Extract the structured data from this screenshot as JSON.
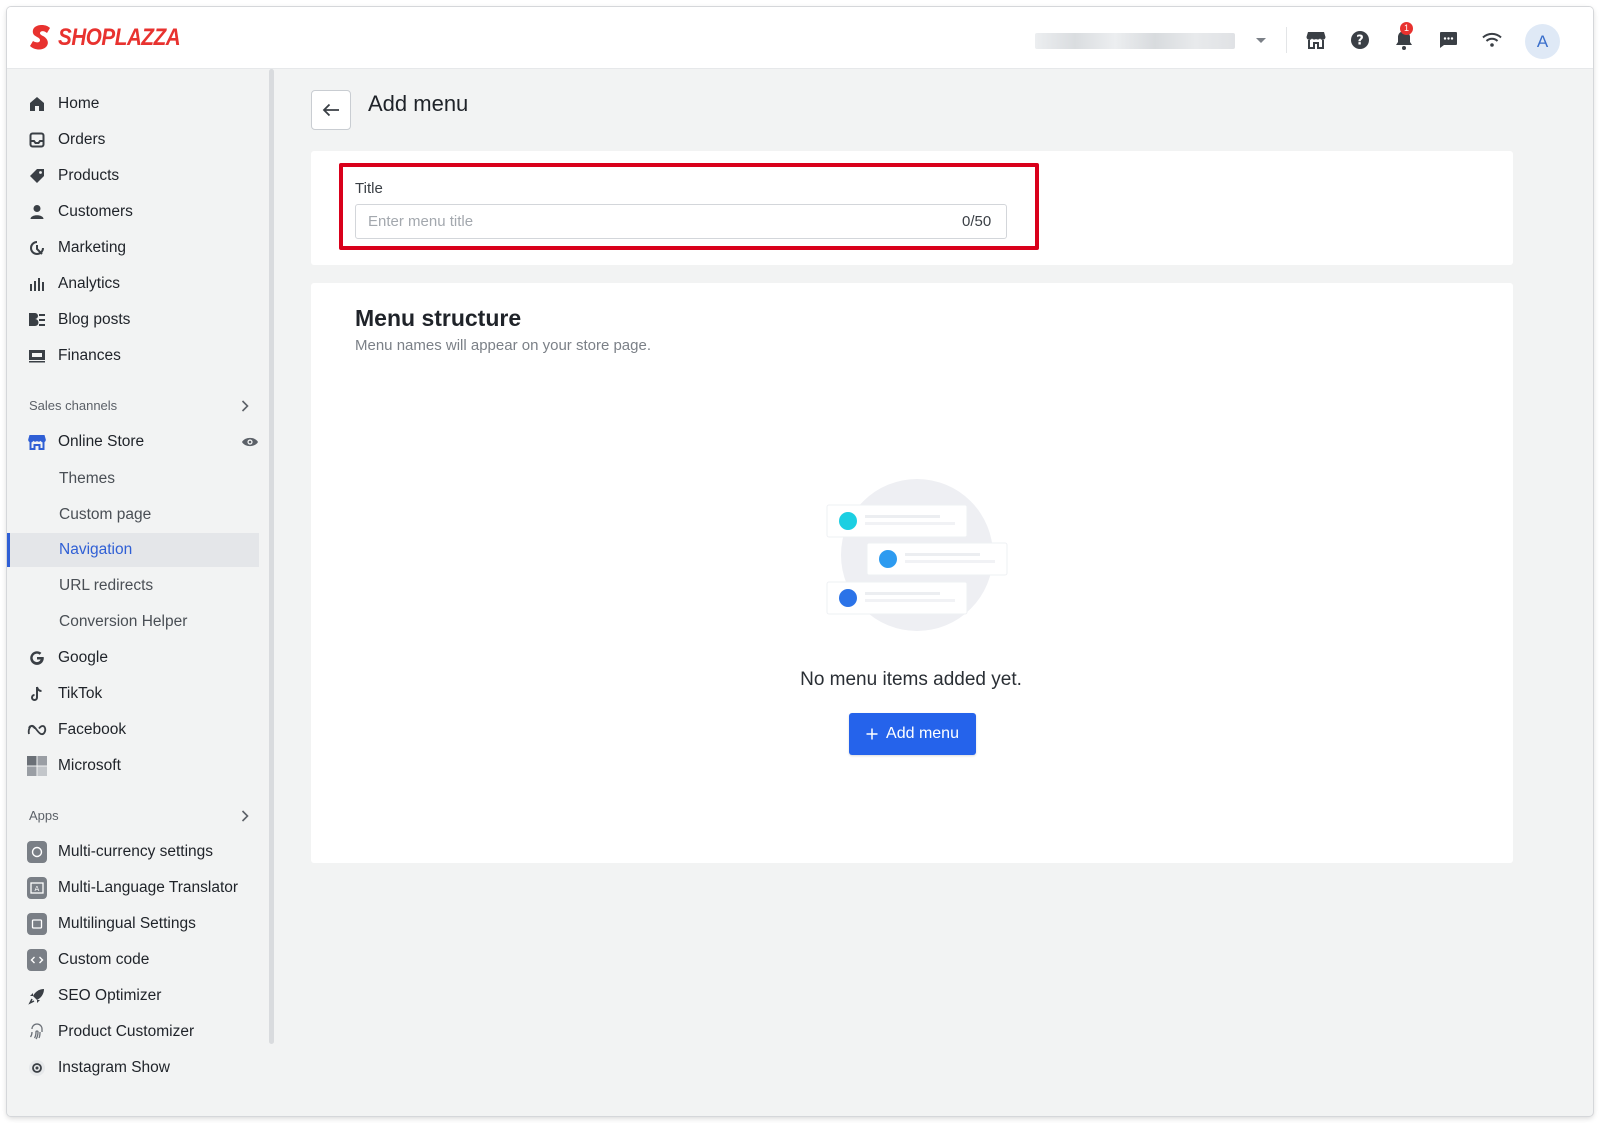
{
  "brand": {
    "name": "SHOPLAZZA",
    "color": "#e8322f"
  },
  "topbar": {
    "icons": [
      "store-icon",
      "help-icon",
      "bell-icon",
      "chat-icon",
      "wifi-icon"
    ],
    "notification_count": "1",
    "avatar_initial": "A"
  },
  "sidebar": {
    "main": [
      {
        "label": "Home",
        "icon": "home-icon"
      },
      {
        "label": "Orders",
        "icon": "orders-icon"
      },
      {
        "label": "Products",
        "icon": "tag-icon"
      },
      {
        "label": "Customers",
        "icon": "person-icon"
      },
      {
        "label": "Marketing",
        "icon": "marketing-icon"
      },
      {
        "label": "Analytics",
        "icon": "bar-chart-icon"
      },
      {
        "label": "Blog posts",
        "icon": "blog-icon"
      },
      {
        "label": "Finances",
        "icon": "finance-icon"
      }
    ],
    "sales_channels_label": "Sales channels",
    "online_store": "Online Store",
    "online_store_sub": [
      "Themes",
      "Custom page",
      "Navigation",
      "URL redirects",
      "Conversion Helper"
    ],
    "channels": [
      {
        "label": "Google",
        "icon": "google-icon"
      },
      {
        "label": "TikTok",
        "icon": "tiktok-icon"
      },
      {
        "label": "Facebook",
        "icon": "meta-icon"
      },
      {
        "label": "Microsoft",
        "icon": "microsoft-icon"
      }
    ],
    "apps_label": "Apps",
    "apps": [
      {
        "label": "Multi-currency settings",
        "icon": "currency-app-icon"
      },
      {
        "label": "Multi-Language Translator",
        "icon": "translator-app-icon"
      },
      {
        "label": "Multilingual Settings",
        "icon": "multilingual-app-icon"
      },
      {
        "label": "Custom code",
        "icon": "code-app-icon"
      },
      {
        "label": "SEO Optimizer",
        "icon": "rocket-icon"
      },
      {
        "label": "Product Customizer",
        "icon": "fingerprint-icon"
      },
      {
        "label": "Instagram Show",
        "icon": "instagram-icon"
      }
    ]
  },
  "main": {
    "page_title": "Add menu",
    "title_field": {
      "label": "Title",
      "placeholder": "Enter menu title",
      "value": "",
      "counter": "0/50"
    },
    "menu_structure": {
      "heading": "Menu structure",
      "subtitle": "Menu names will appear on your store page.",
      "empty_text": "No menu items added yet.",
      "add_button": "Add menu"
    }
  },
  "colors": {
    "primary": "#2563eb",
    "highlight": "#d9001b",
    "active_nav": "#2f5fd5"
  }
}
